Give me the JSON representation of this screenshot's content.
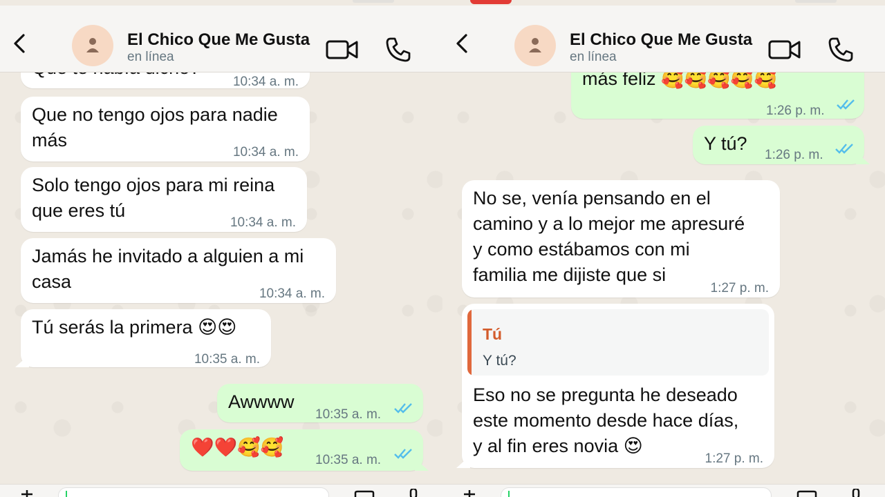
{
  "contact": {
    "name": "El Chico Que Me Gusta",
    "status": "en línea"
  },
  "left": {
    "messages": [
      {
        "text": "Que te había dicho?",
        "time": "10:34 a. m."
      },
      {
        "text": "Que no tengo ojos para nadie\nmás",
        "time": "10:34 a. m."
      },
      {
        "text": "Solo tengo ojos para mi reina\nque eres tú",
        "time": "10:34 a. m."
      },
      {
        "text": "Jamás he invitado a alguien a mi\ncasa",
        "time": "10:34 a. m."
      },
      {
        "text": "Tú serás la primera 😍😍",
        "time": "10:35 a. m."
      },
      {
        "text": "Awwww",
        "time": "10:35 a. m."
      },
      {
        "text": "❤️❤️🥰🥰",
        "time": "10:35 a. m."
      }
    ]
  },
  "right": {
    "messages": [
      {
        "text": "más feliz 🥰🥰🥰🥰🥰",
        "time": "1:26 p. m."
      },
      {
        "text": "Y tú?",
        "time": "1:26 p. m."
      },
      {
        "text": "No se, venía pensando en el\ncamino y a lo mejor me apresuré\ny como estábamos con mi\nfamilia me dijiste que si",
        "time": "1:27 p. m."
      },
      {
        "quote_author": "Tú",
        "quote_text": "Y tú?",
        "text": "Eso no se pregunta he deseado\neste momento desde hace días,\ny al fin eres novia 😍",
        "time": "1:27 p. m."
      }
    ]
  },
  "colors": {
    "incoming": "#ffffff",
    "outgoing": "#d9fdd3",
    "read_ticks": "#53bdeb",
    "quote_accent": "#d35b2b"
  },
  "icons": [
    "back-icon",
    "person-icon",
    "video-call-icon",
    "phone-icon",
    "read-ticks-icon",
    "plus-icon",
    "camera-icon",
    "mic-icon"
  ]
}
